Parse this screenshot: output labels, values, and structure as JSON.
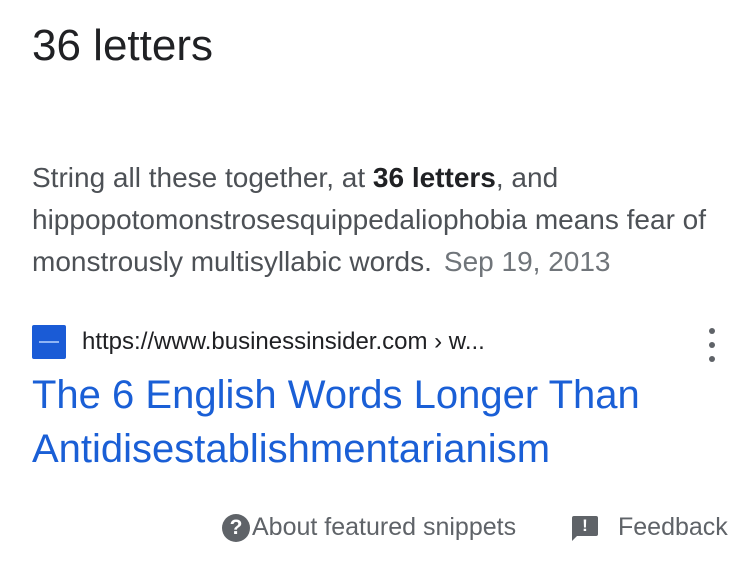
{
  "answer": {
    "text": "36 letters"
  },
  "snippet": {
    "before": "String all these together, at ",
    "highlight": "36 letters",
    "after": ", and hippopotomonstrosesquippedaliophobia means fear of monstrously multisyllabic words.",
    "date": "Sep 19, 2013"
  },
  "source": {
    "url": "https://www.businessinsider.com › w...",
    "favicon_color": "#1a5bd6"
  },
  "result": {
    "title": "The 6 English Words Longer Than Antidisestablishmentarianism"
  },
  "footer": {
    "about_label": "About featured snippets",
    "feedback_label": "Feedback"
  },
  "colors": {
    "link": "#1a5fd6",
    "text": "#202124",
    "secondary": "#5f6368"
  }
}
